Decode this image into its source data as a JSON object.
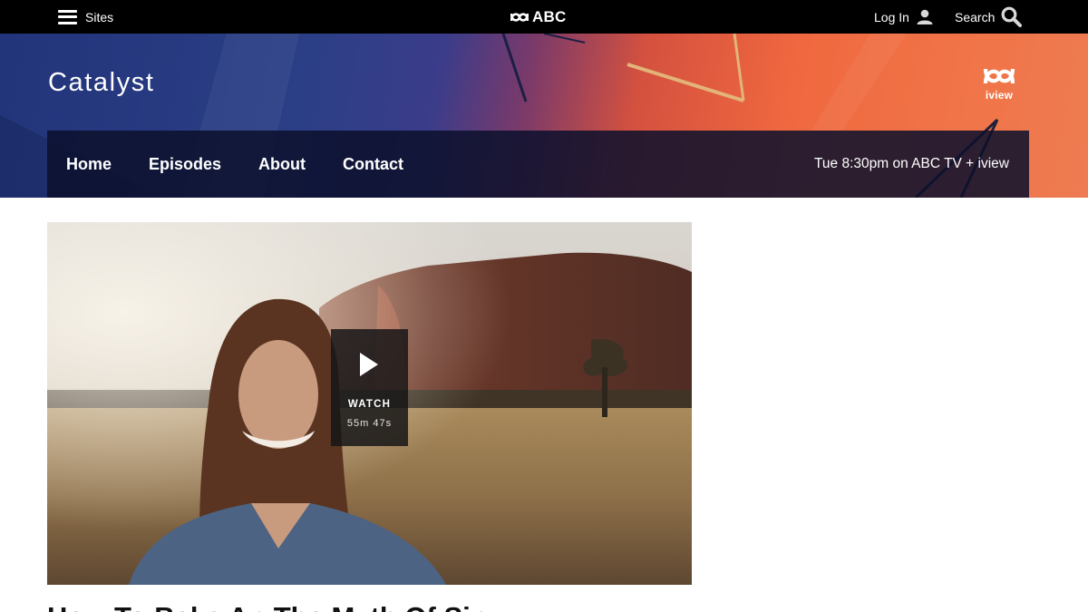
{
  "topbar": {
    "sites_label": "Sites",
    "brand_label": "ABC",
    "login_label": "Log In",
    "search_label": "Search"
  },
  "banner": {
    "show_title": "Catalyst",
    "iview_label": "iview",
    "nav": [
      "Home",
      "Episodes",
      "About",
      "Contact"
    ],
    "airtime": "Tue 8:30pm on ABC TV + iview"
  },
  "video": {
    "watch_label": "WATCH",
    "duration": "55m 47s"
  },
  "episode": {
    "title": "How To Bake An The Myth Of Sin"
  },
  "colors": {
    "topbar_bg": "#000000",
    "banner_blue": "#2b3f86",
    "banner_orange": "#f0683f",
    "showbar_bg": "#0c102c",
    "watch_bg": "#141416"
  },
  "icons": [
    "hamburger-icon",
    "abc-logo-icon",
    "user-icon",
    "search-icon",
    "iview-logo-icon",
    "play-icon"
  ]
}
